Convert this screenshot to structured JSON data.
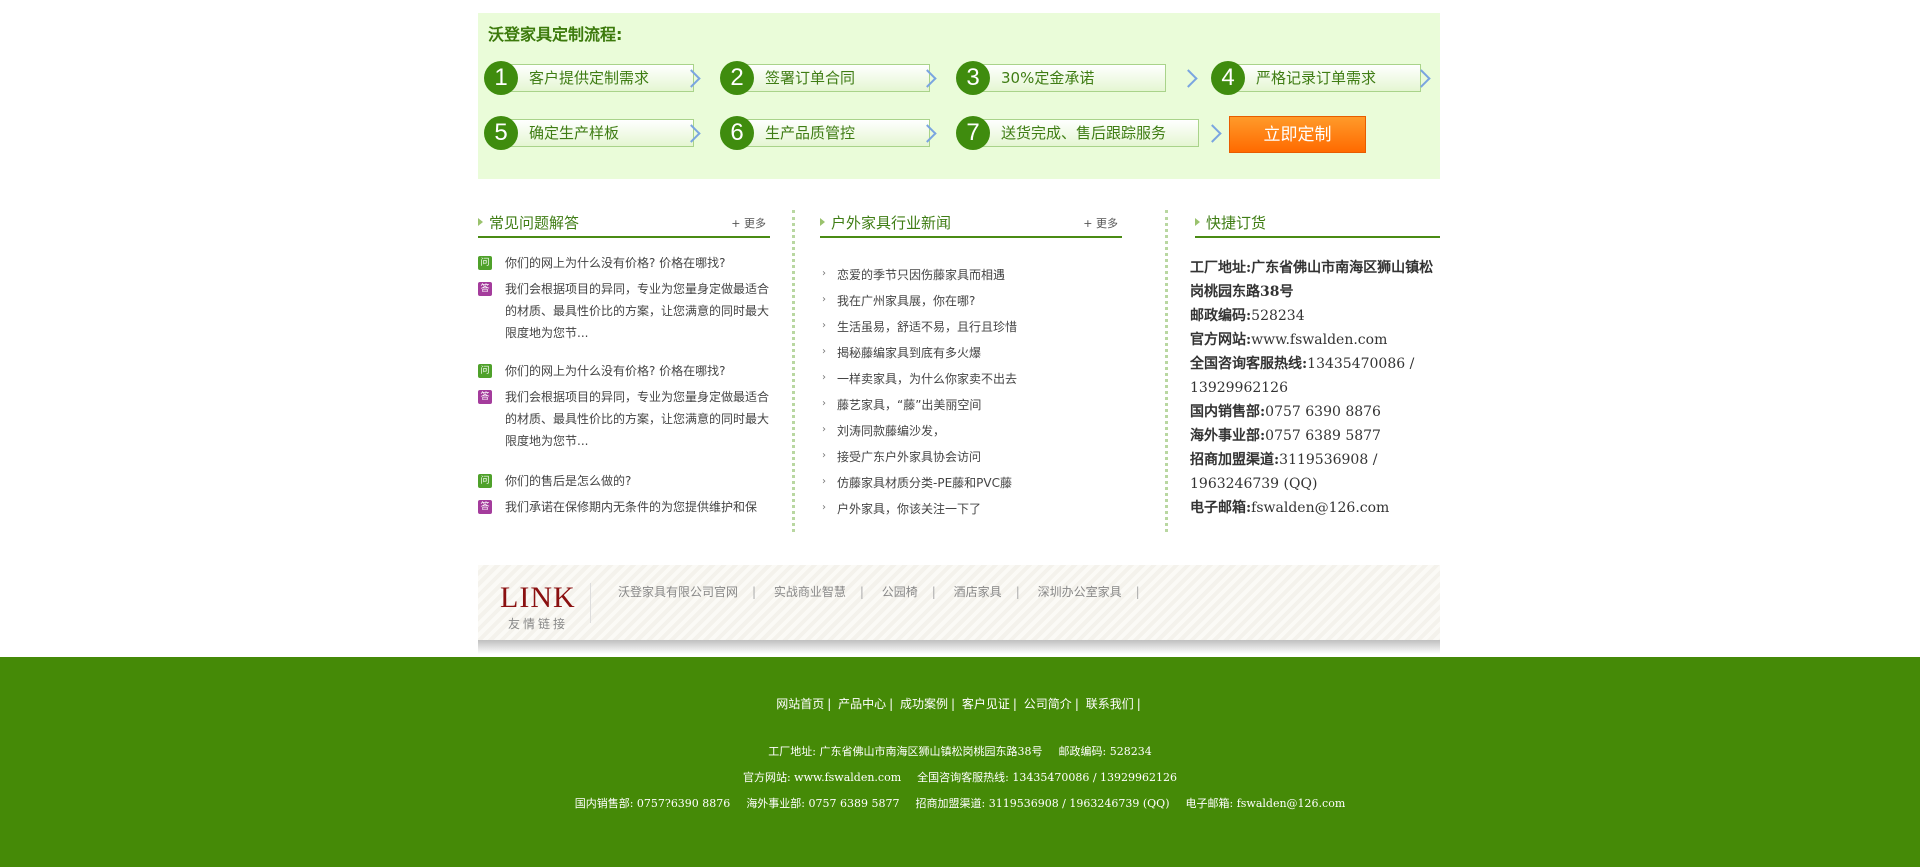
{
  "process": {
    "title": "沃登家具定制流程:",
    "steps": [
      {
        "num": "1",
        "label": "客户提供定制需求"
      },
      {
        "num": "2",
        "label": "签署订单合同"
      },
      {
        "num": "3",
        "label": "30%定金承诺"
      },
      {
        "num": "4",
        "label": "严格记录订单需求"
      },
      {
        "num": "5",
        "label": "确定生产样板"
      },
      {
        "num": "6",
        "label": "生产品质管控"
      },
      {
        "num": "7",
        "label": "送货完成、售后跟踪服务"
      }
    ],
    "cta": "立即定制"
  },
  "faq": {
    "title": "常见问题解答",
    "more": "+ 更多",
    "q_badge": "问",
    "a_badge": "答",
    "items": [
      {
        "q": "你们的网上为什么没有价格? 价格在哪找?",
        "a": "我们会根据项目的异同，专业为您量身定做最适合的材质、最具性价比的方案，让您满意的同时最大限度地为您节..."
      },
      {
        "q": "你们的网上为什么没有价格? 价格在哪找?",
        "a": "我们会根据项目的异同，专业为您量身定做最适合的材质、最具性价比的方案，让您满意的同时最大限度地为您节..."
      },
      {
        "q": "你们的售后是怎么做的?",
        "a": "我们承诺在保修期内无条件的为您提供维护和保"
      }
    ]
  },
  "news": {
    "title": "户外家具行业新闻",
    "more": "+ 更多",
    "items": [
      "恋爱的季节只因伤藤家具而相遇",
      "我在广州家具展，你在哪?",
      "生活虽易，舒适不易，且行且珍惜",
      "揭秘藤编家具到底有多火爆",
      "一样卖家具，为什么你家卖不出去",
      "藤艺家具，“藤”出美丽空间",
      "刘涛同款藤编沙发，",
      "接受广东户外家具协会访问",
      "仿藤家具材质分类-PE藤和PVC藤",
      "户外家具，你该关注一下了"
    ]
  },
  "quick": {
    "title": "快捷订货",
    "lines": [
      {
        "label": "工厂地址:",
        "value": "广东省佛山市南海区狮山镇松岗桃园东路38号"
      },
      {
        "label": "邮政编码:",
        "value": "528234"
      },
      {
        "label": "官方网站:",
        "value": "www.fswalden.com"
      },
      {
        "label": "全国咨询客服热线:",
        "value": "13435470086 / 13929962126"
      },
      {
        "label": "国内销售部:",
        "value": "0757 6390 8876"
      },
      {
        "label": "海外事业部:",
        "value": "0757 6389 5877"
      },
      {
        "label": "招商加盟渠道:",
        "value": "3119536908 / 1963246739 (QQ)"
      },
      {
        "label": "电子邮箱:",
        "value": "fswalden@126.com"
      }
    ]
  },
  "links": {
    "logo": "LINK",
    "logo_sub": "友情链接",
    "items": [
      "沃登家具有限公司官网",
      "实战商业智慧",
      "公园椅",
      "酒店家具",
      "深圳办公室家具"
    ],
    "sep": "|"
  },
  "footer": {
    "nav": [
      "网站首页",
      "产品中心",
      "成功案例",
      "客户见证",
      "公司简介",
      "联系我们"
    ],
    "sep": "|",
    "line1": [
      "工厂地址: 广东省佛山市南海区狮山镇松岗桃园东路38号",
      "邮政编码: 528234"
    ],
    "line2": [
      "官方网站: www.fswalden.com",
      "全国咨询客服热线: 13435470086 / 13929962126"
    ],
    "line3": [
      "国内销售部: 0757?6390 8876",
      "海外事业部: 0757 6389 5877",
      "招商加盟渠道: 3119536908 / 1963246739 (QQ)",
      "电子邮箱: fswalden@126.com"
    ]
  }
}
